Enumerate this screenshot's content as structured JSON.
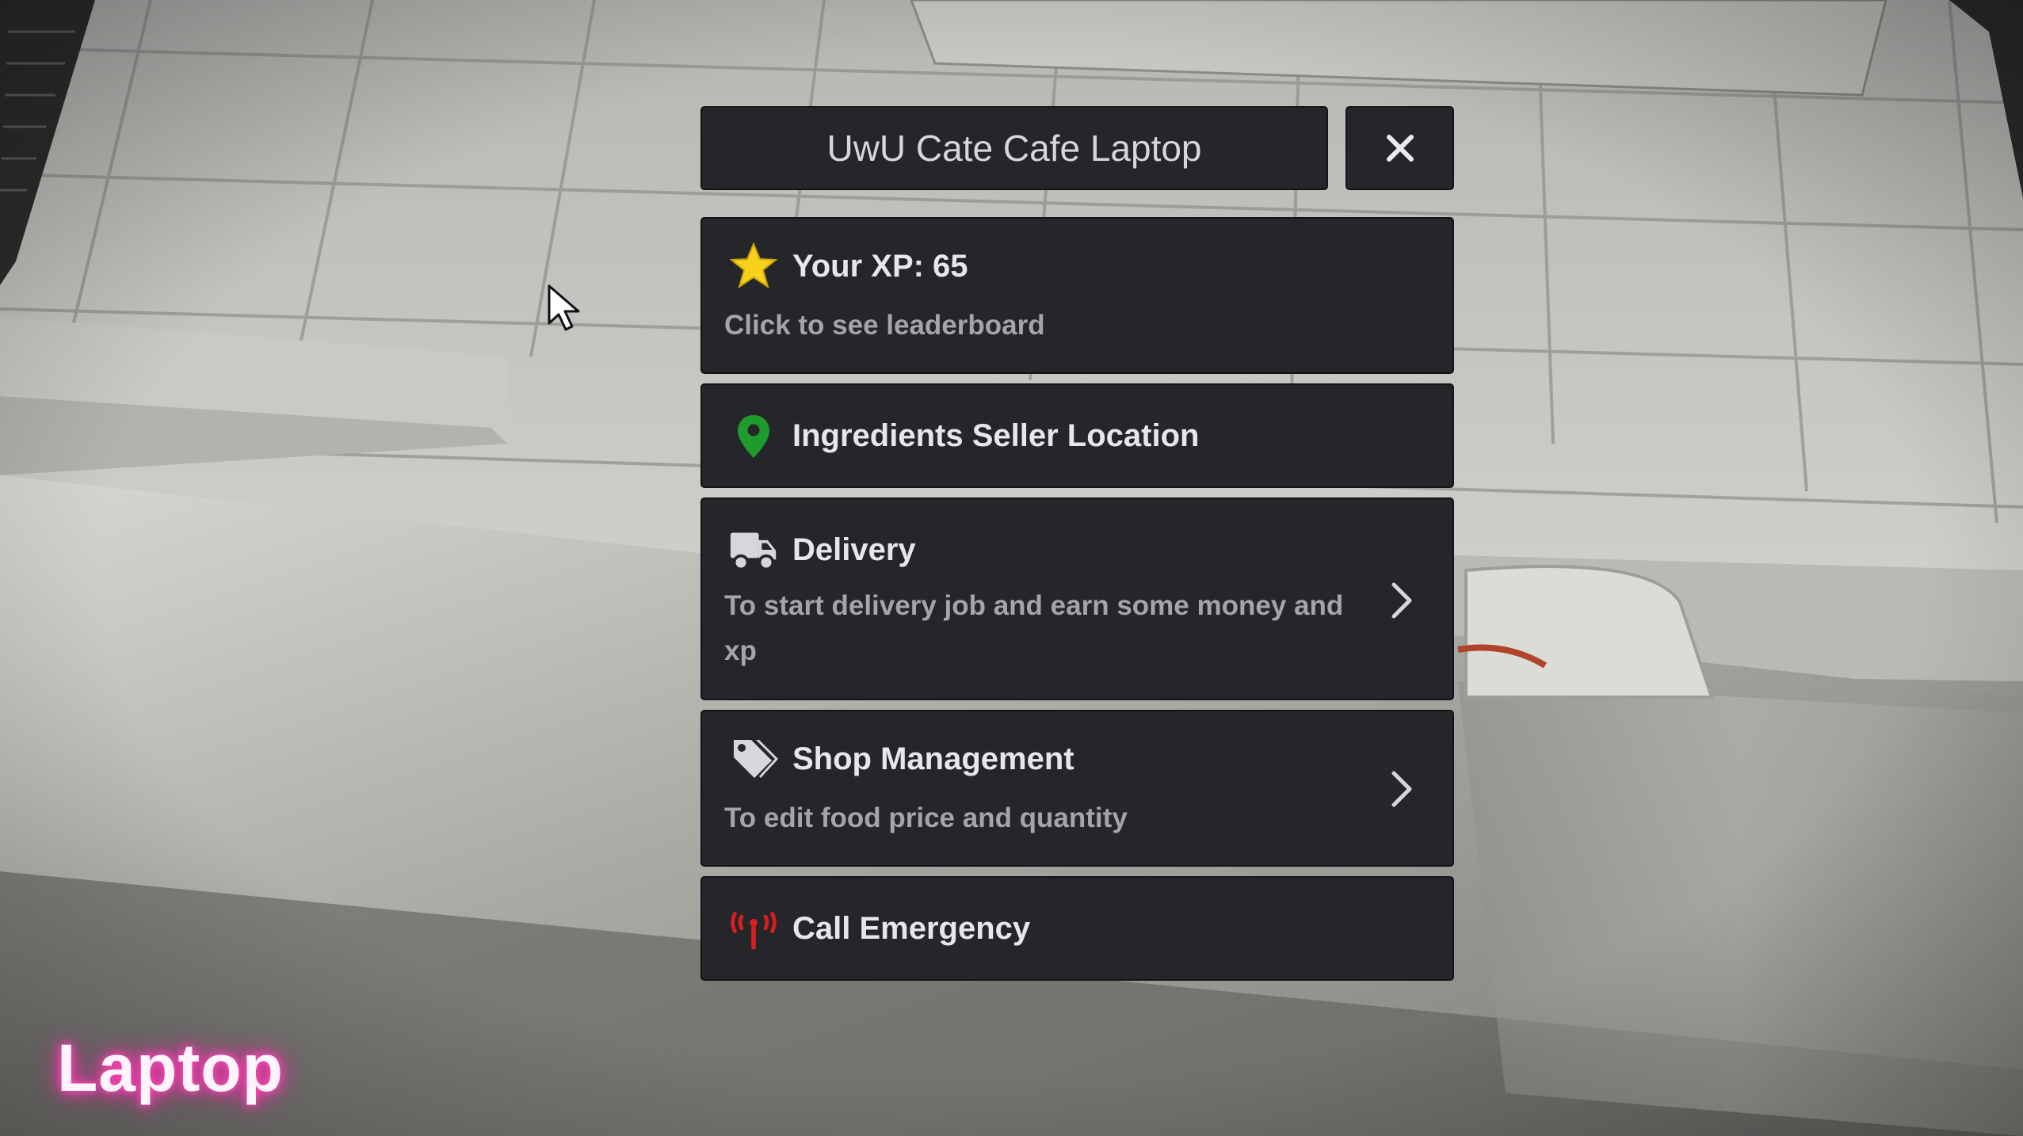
{
  "window": {
    "title": "UwU Cate Cafe Laptop",
    "close_icon": "close-icon"
  },
  "menu_items": [
    {
      "id": "xp",
      "icon": "star-icon",
      "icon_color": "#f6d21c",
      "title": "Your XP: 65",
      "description": "Click to see leaderboard",
      "has_submenu": false
    },
    {
      "id": "ingredients",
      "icon": "map-pin-icon",
      "icon_color": "#1d9b2c",
      "title": "Ingredients Seller Location",
      "description": "",
      "has_submenu": false
    },
    {
      "id": "delivery",
      "icon": "truck-icon",
      "icon_color": "#d6d7da",
      "title": "Delivery",
      "description": "To start delivery job and earn some money and xp",
      "has_submenu": true
    },
    {
      "id": "shop",
      "icon": "tags-icon",
      "icon_color": "#d6d7da",
      "title": "Shop Management",
      "description": "To edit food price and quantity",
      "has_submenu": true
    },
    {
      "id": "emergency",
      "icon": "signal-tower-icon",
      "icon_color": "#d81e1e",
      "title": "Call Emergency",
      "description": "",
      "has_submenu": false
    }
  ],
  "caption": {
    "text": "Laptop",
    "glow_color": "#ff2fae"
  },
  "colors": {
    "panel_bg": "#25262a",
    "panel_border": "#131416",
    "title_text": "#d6d7da",
    "item_title_text": "#e6e7ea",
    "item_desc_text": "#a3a5ab"
  }
}
